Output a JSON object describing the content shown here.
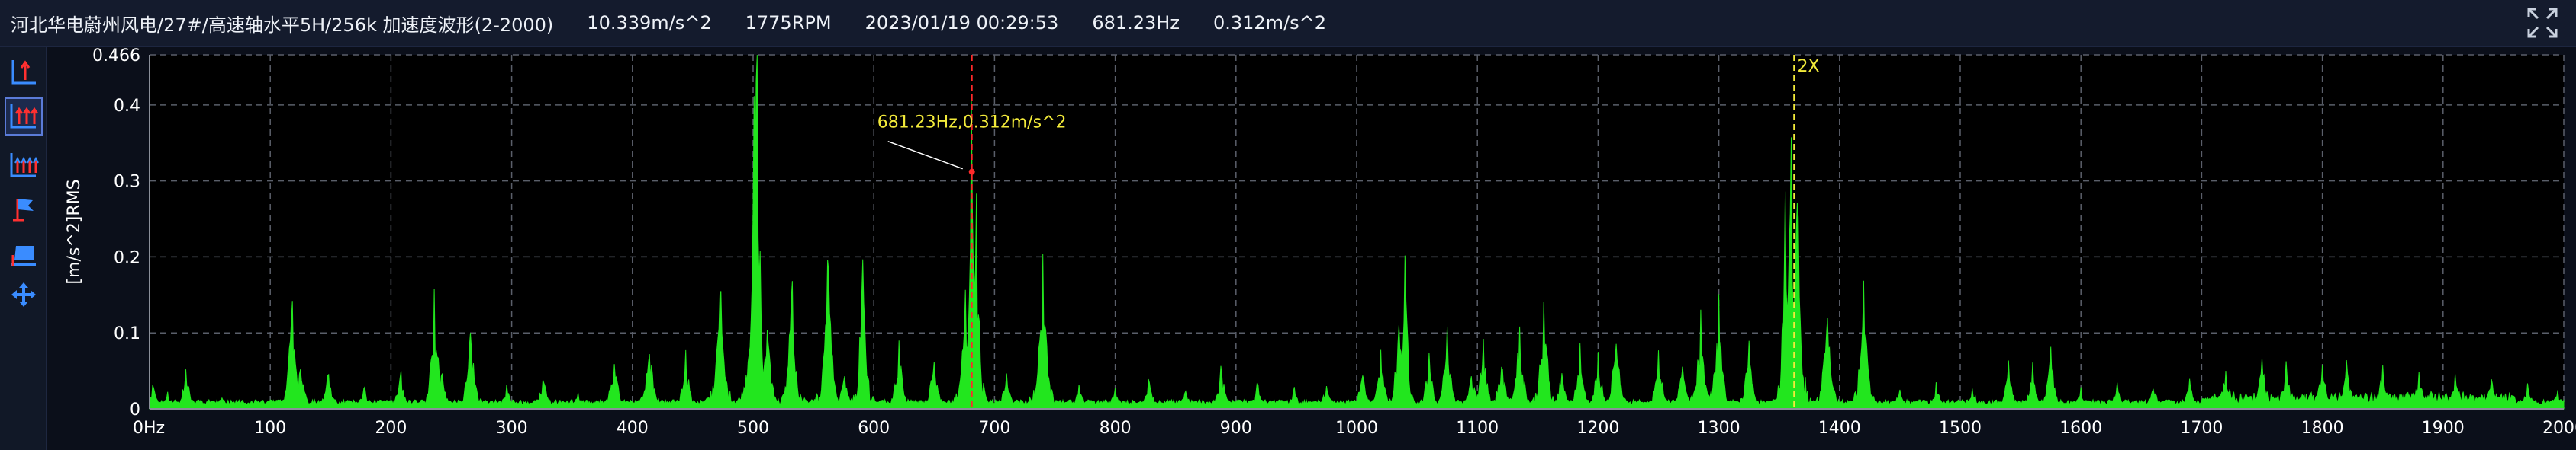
{
  "header": {
    "title": "河北华电蔚州风电/27#/高速轴水平5H/256k 加速度波形(2-2000)",
    "value1": "10.339m/s^2",
    "rpm": "1775RPM",
    "datetime": "2023/01/19 00:29:53",
    "cursor_freq": "681.23Hz",
    "cursor_amp": "0.312m/s^2"
  },
  "toolbar": {
    "items": [
      {
        "name": "single-cursor-icon"
      },
      {
        "name": "multi-cursor-icon"
      },
      {
        "name": "harmonic-cursor-icon"
      },
      {
        "name": "flag-icon"
      },
      {
        "name": "display-settings-icon"
      },
      {
        "name": "pan-icon"
      }
    ]
  },
  "colors": {
    "series": "#22e61e",
    "cursor": "#ff2a2a",
    "harmonic": "#f2ea3a",
    "annotation": "#f2ea3a",
    "grid": "#5a5f6a",
    "background": "#000000"
  },
  "chart_data": {
    "type": "area",
    "title": "",
    "xlabel": "",
    "ylabel": "[m/s^2]RMS",
    "xlim": [
      0,
      2000
    ],
    "ylim": [
      0,
      0.466
    ],
    "grid": true,
    "x_ticks": [
      0,
      100,
      200,
      300,
      400,
      500,
      600,
      700,
      800,
      900,
      1000,
      1100,
      1200,
      1300,
      1400,
      1500,
      1600,
      1700,
      1800,
      1900,
      2000
    ],
    "x_tick_labels": [
      "0Hz",
      "100",
      "200",
      "300",
      "400",
      "500",
      "600",
      "700",
      "800",
      "900",
      "1000",
      "1100",
      "1200",
      "1300",
      "1400",
      "1500",
      "1600",
      "1700",
      "1800",
      "1900",
      "2000"
    ],
    "y_ticks": [
      0,
      0.1,
      0.2,
      0.3,
      0.4,
      0.466
    ],
    "y_tick_labels": [
      "0",
      "0.1",
      "0.2",
      "0.3",
      "0.4",
      "0.466"
    ],
    "series": [
      {
        "peaks": [
          [
            3,
            0.025
          ],
          [
            15,
            0.018
          ],
          [
            30,
            0.04
          ],
          [
            60,
            0.012
          ],
          [
            90,
            0.008
          ],
          [
            118,
            0.105
          ],
          [
            125,
            0.05
          ],
          [
            148,
            0.04
          ],
          [
            178,
            0.02
          ],
          [
            208,
            0.035
          ],
          [
            236,
            0.112
          ],
          [
            242,
            0.04
          ],
          [
            266,
            0.09
          ],
          [
            296,
            0.025
          ],
          [
            326,
            0.035
          ],
          [
            355,
            0.015
          ],
          [
            385,
            0.055
          ],
          [
            414,
            0.07
          ],
          [
            444,
            0.055
          ],
          [
            473,
            0.135
          ],
          [
            501,
            0.3
          ],
          [
            503,
            0.42
          ],
          [
            512,
            0.085
          ],
          [
            532,
            0.12
          ],
          [
            562,
            0.145
          ],
          [
            576,
            0.04
          ],
          [
            591,
            0.175
          ],
          [
            621,
            0.065
          ],
          [
            650,
            0.055
          ],
          [
            676,
            0.11
          ],
          [
            681,
            0.312
          ],
          [
            685,
            0.2
          ],
          [
            710,
            0.035
          ],
          [
            740,
            0.145
          ],
          [
            770,
            0.025
          ],
          [
            800,
            0.02
          ],
          [
            828,
            0.03
          ],
          [
            858,
            0.02
          ],
          [
            888,
            0.04
          ],
          [
            918,
            0.025
          ],
          [
            948,
            0.02
          ],
          [
            975,
            0.025
          ],
          [
            1005,
            0.04
          ],
          [
            1020,
            0.06
          ],
          [
            1035,
            0.095
          ],
          [
            1040,
            0.155
          ],
          [
            1060,
            0.055
          ],
          [
            1075,
            0.08
          ],
          [
            1095,
            0.04
          ],
          [
            1105,
            0.065
          ],
          [
            1120,
            0.055
          ],
          [
            1135,
            0.085
          ],
          [
            1155,
            0.115
          ],
          [
            1170,
            0.04
          ],
          [
            1185,
            0.06
          ],
          [
            1200,
            0.055
          ],
          [
            1215,
            0.085
          ],
          [
            1250,
            0.06
          ],
          [
            1270,
            0.045
          ],
          [
            1285,
            0.09
          ],
          [
            1300,
            0.11
          ],
          [
            1325,
            0.065
          ],
          [
            1355,
            0.2
          ],
          [
            1360,
            0.285
          ],
          [
            1365,
            0.27
          ],
          [
            1390,
            0.11
          ],
          [
            1420,
            0.12
          ],
          [
            1450,
            0.02
          ],
          [
            1480,
            0.025
          ],
          [
            1510,
            0.025
          ],
          [
            1540,
            0.045
          ],
          [
            1560,
            0.045
          ],
          [
            1575,
            0.065
          ],
          [
            1600,
            0.02
          ],
          [
            1630,
            0.025
          ],
          [
            1660,
            0.025
          ],
          [
            1690,
            0.03
          ],
          [
            1720,
            0.045
          ],
          [
            1750,
            0.055
          ],
          [
            1770,
            0.045
          ],
          [
            1800,
            0.045
          ],
          [
            1820,
            0.05
          ],
          [
            1850,
            0.045
          ],
          [
            1880,
            0.035
          ],
          [
            1910,
            0.04
          ],
          [
            1940,
            0.035
          ],
          [
            1970,
            0.025
          ],
          [
            1995,
            0.02
          ]
        ]
      }
    ],
    "cursor": {
      "x": 681.23,
      "y": 0.312,
      "label": "681.23Hz,0.312m/s^2"
    },
    "harmonic_marker": {
      "x": 1362.5,
      "label": "2X"
    }
  }
}
